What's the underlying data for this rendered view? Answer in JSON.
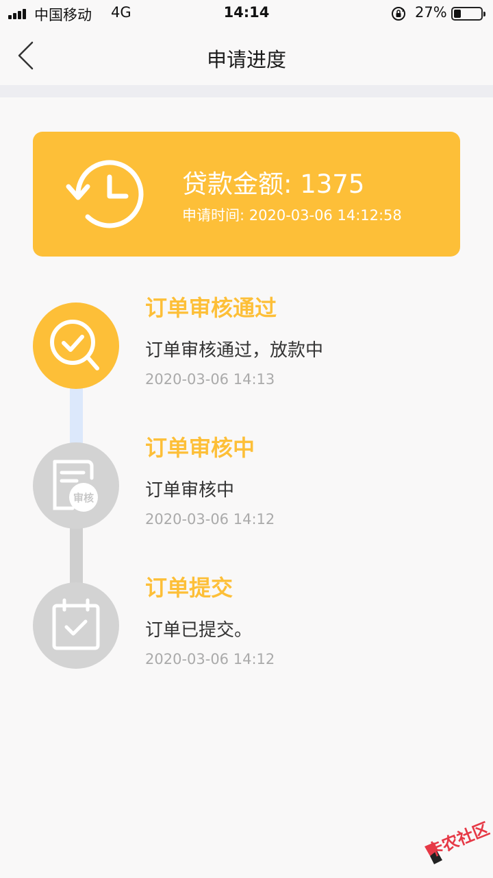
{
  "status_bar": {
    "carrier": "中国移动",
    "network": "4G",
    "time": "14:14",
    "battery_percent": "27%",
    "battery_level": 0.27
  },
  "nav": {
    "title": "申请进度",
    "back_icon": "chevron-left-icon"
  },
  "card": {
    "loan_amount": "贷款金额: 1375",
    "apply_time": "申请时间: 2020-03-06 14:12:58",
    "icon": "clock-history-icon",
    "color": "#fdbf38"
  },
  "timeline": [
    {
      "title": "订单审核通过",
      "desc": "订单审核通过，放款中",
      "time": "2020-03-06 14:13",
      "icon": "search-check-icon",
      "active": true
    },
    {
      "title": "订单审核中",
      "desc": "订单审核中",
      "time": "2020-03-06 14:12",
      "icon": "review-document-icon",
      "icon_label": "审核",
      "active": false
    },
    {
      "title": "订单提交",
      "desc": "订单已提交。",
      "time": "2020-03-06 14:12",
      "icon": "calendar-check-icon",
      "active": false
    }
  ],
  "colors": {
    "accent": "#fdbf38",
    "inactive": "#d0d0d0",
    "active_line": "#dce8fb"
  },
  "watermark": {
    "text": "卡农社区"
  }
}
